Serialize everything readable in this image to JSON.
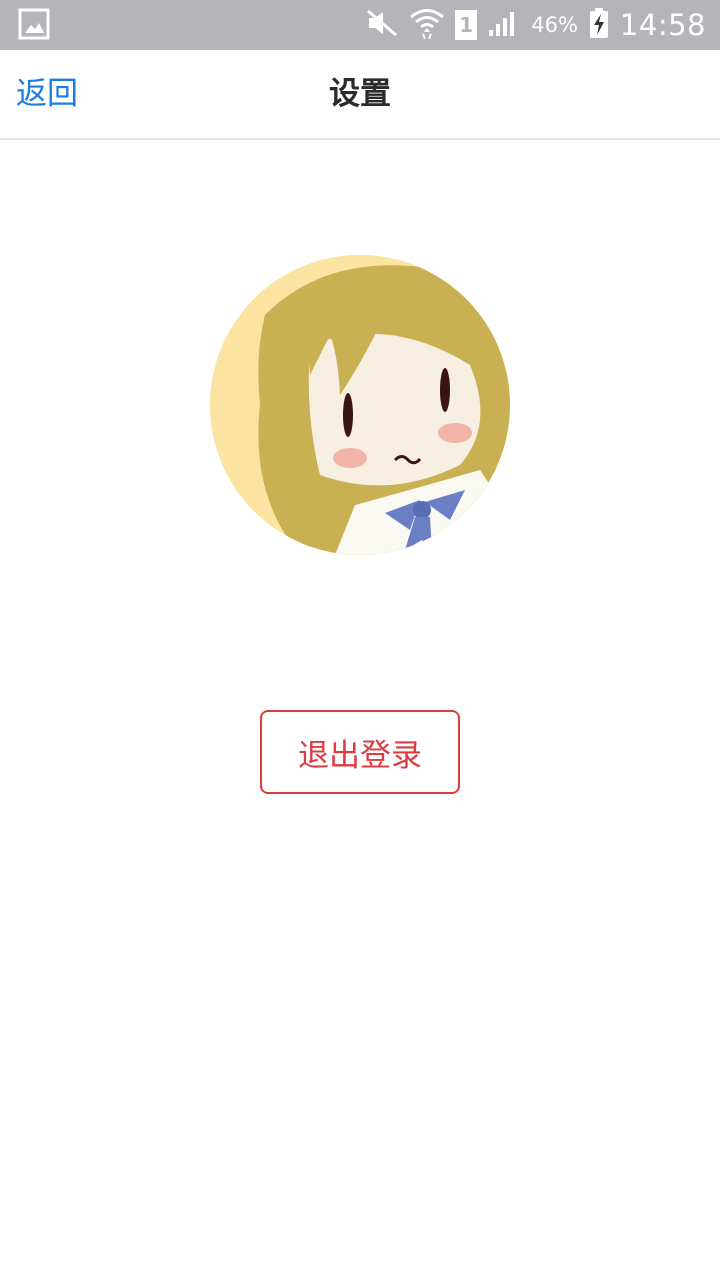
{
  "status_bar": {
    "battery_percent": "46%",
    "time": "14:58",
    "sim_slot": "1",
    "icons": [
      "gallery-notification-icon",
      "mute-icon",
      "wifi-icon",
      "sim-icon",
      "signal-icon",
      "battery-charging-icon"
    ]
  },
  "header": {
    "back_label": "返回",
    "title": "设置"
  },
  "profile": {
    "avatar_icon": "user-avatar"
  },
  "actions": {
    "logout_label": "退出登录"
  },
  "colors": {
    "status_bar_bg": "#b4b4b9",
    "link_blue": "#1a7de6",
    "danger_red": "#dc3c42",
    "divider": "#e3e3e3"
  }
}
